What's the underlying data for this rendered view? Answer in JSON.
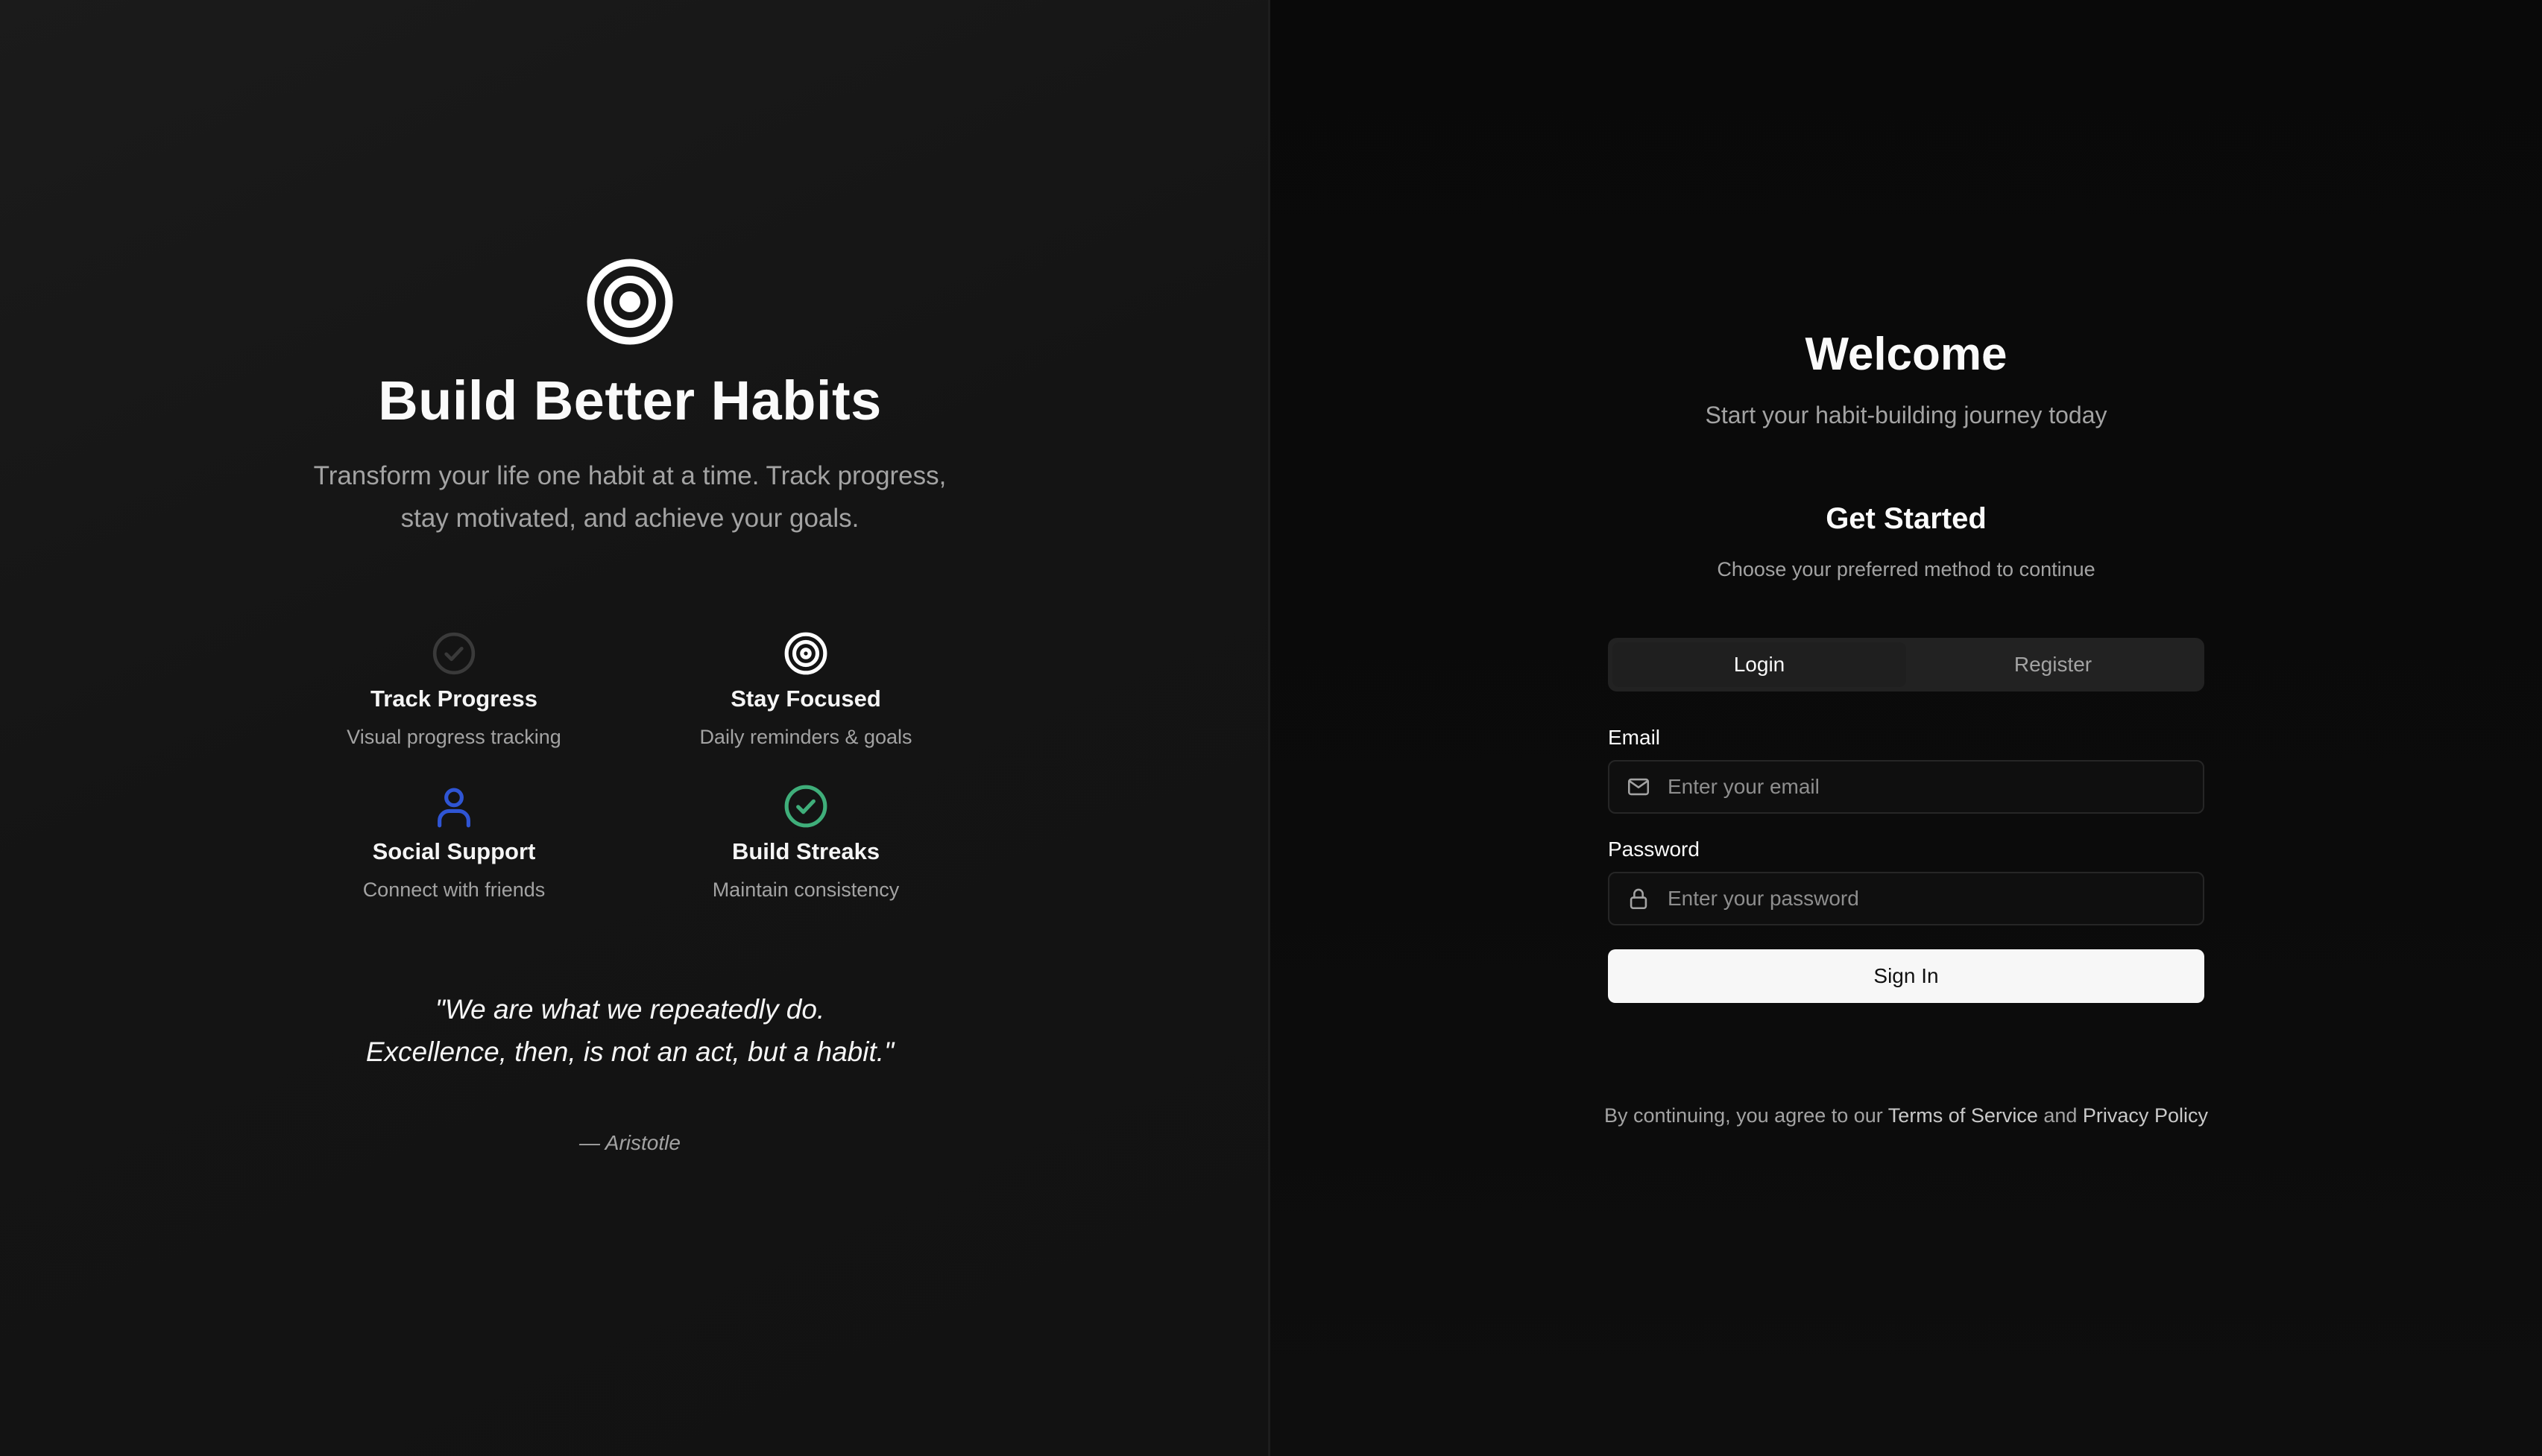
{
  "hero": {
    "icon": "target-icon",
    "title": "Build Better Habits",
    "subtitle": "Transform your life one habit at a time. Track progress, stay motivated, and achieve your goals."
  },
  "features": [
    {
      "icon": "check-circle-icon",
      "title": "Track Progress",
      "desc": "Visual progress tracking",
      "color": "#3a3a3a"
    },
    {
      "icon": "target-icon",
      "title": "Stay Focused",
      "desc": "Daily reminders & goals",
      "color": "#ffffff"
    },
    {
      "icon": "user-icon",
      "title": "Social Support",
      "desc": "Connect with friends",
      "color": "#2f55d4"
    },
    {
      "icon": "check-circle-icon",
      "title": "Build Streaks",
      "desc": "Maintain consistency",
      "color": "#3fae7a"
    }
  ],
  "quote": {
    "line1": "\"We are what we repeatedly do.",
    "line2": "Excellence, then, is not an act, but a habit.\"",
    "author": "— Aristotle"
  },
  "auth": {
    "welcome": "Welcome",
    "welcome_sub": "Start your habit-building journey today",
    "get_started": "Get Started",
    "choose": "Choose your preferred method to continue",
    "tabs": [
      {
        "label": "Login",
        "active": true
      },
      {
        "label": "Register",
        "active": false
      }
    ],
    "email_label": "Email",
    "email_placeholder": "Enter your email",
    "email_value": "",
    "email_icon": "mail-icon",
    "password_label": "Password",
    "password_placeholder": "Enter your password",
    "password_value": "",
    "password_icon": "lock-icon",
    "signin_label": "Sign In",
    "terms_prefix": "By continuing, you agree to our ",
    "terms_link": "Terms of Service",
    "terms_and": " and ",
    "privacy_link": "Privacy Policy"
  }
}
